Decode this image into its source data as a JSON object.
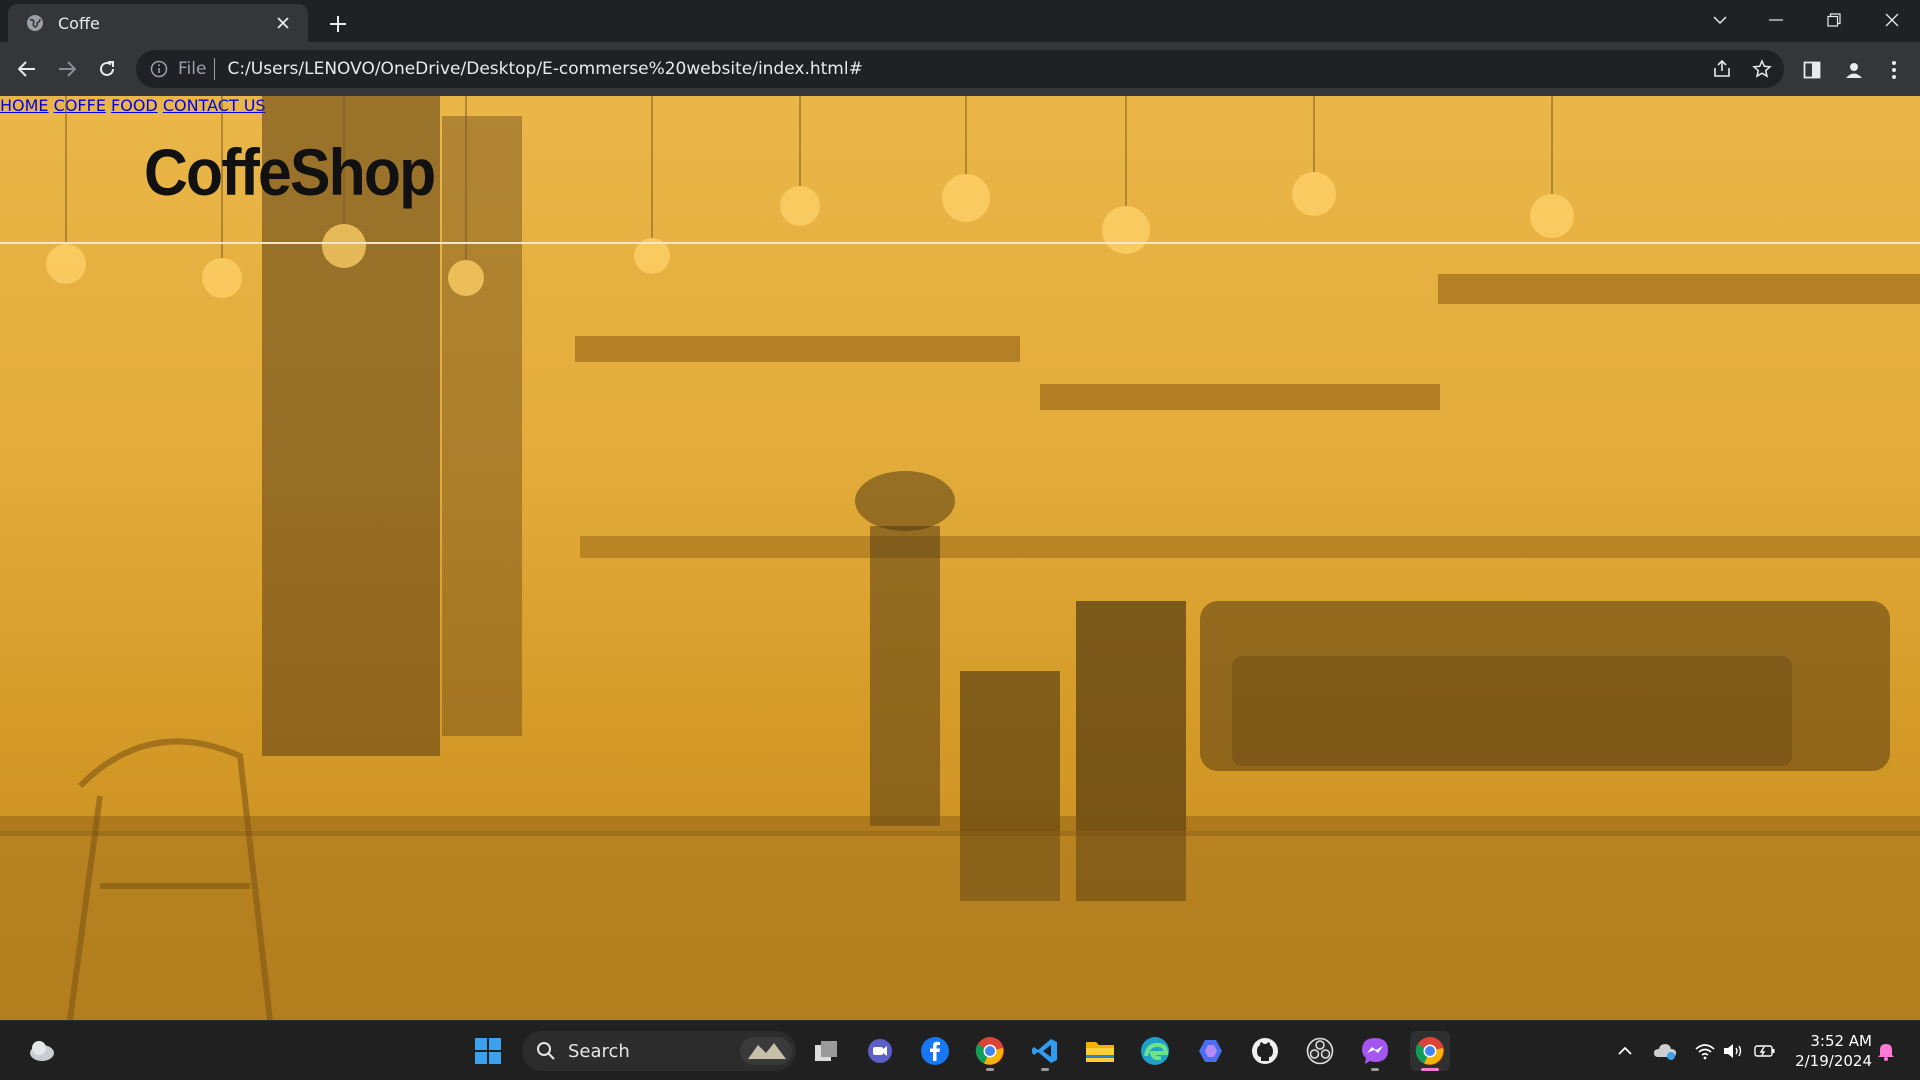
{
  "browser": {
    "tab_title": "Coffe",
    "address_prefix": "File",
    "url": "C:/Users/LENOVO/OneDrive/Desktop/E-commerse%20website/index.html#"
  },
  "page": {
    "brand": "CoffeShop",
    "nav": [
      "HOME",
      "COFFE",
      "FOOD",
      "CONTACT US"
    ],
    "overlay_color": "#e9aa23",
    "nav_color": "#ffffff",
    "brand_color": "#111111"
  },
  "taskbar": {
    "search_label": "Search",
    "time": "3:52 AM",
    "date": "2/19/2024",
    "apps": [
      "widgets-icon",
      "start-icon",
      "search-icon",
      "task-view-icon",
      "meet-icon",
      "facebook-icon",
      "chrome-icon",
      "vscode-icon",
      "file-explorer-icon",
      "edge-icon",
      "copilot-icon",
      "github-icon",
      "obs-icon",
      "messenger-icon",
      "chrome-icon"
    ]
  }
}
